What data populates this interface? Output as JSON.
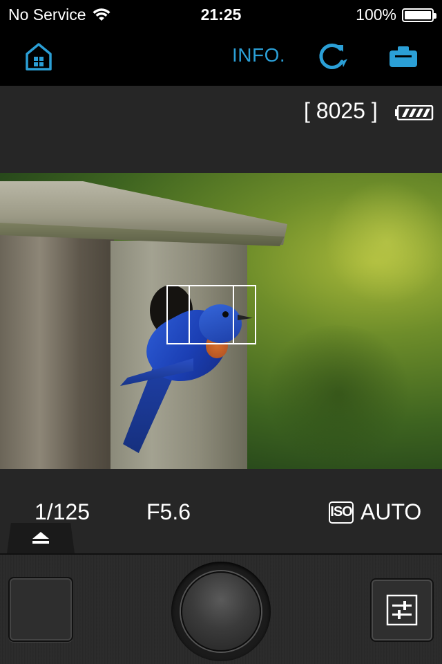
{
  "status_bar": {
    "carrier": "No Service",
    "time": "21:25",
    "battery_percent": "100%"
  },
  "toolbar": {
    "info_label": "INFO.",
    "icons": [
      "home-icon",
      "refresh-icon",
      "camera-icon"
    ],
    "accent_color": "#2b9fd6"
  },
  "camera_info": {
    "remaining_shots": "[ 8025 ]",
    "battery_level": 1.0
  },
  "exposure": {
    "shutter_speed": "1/125",
    "aperture": "F5.6",
    "iso_label": "ISO",
    "iso_value": "AUTO"
  },
  "controls": {
    "icons": [
      "eject-icon",
      "shutter-button",
      "settings-sliders-icon"
    ]
  }
}
